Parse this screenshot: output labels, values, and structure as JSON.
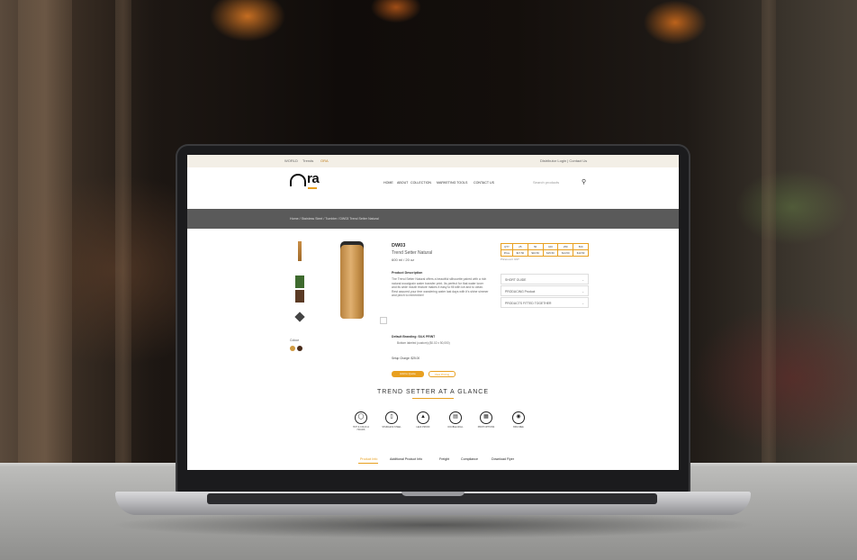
{
  "site": {
    "topbar_left": [
      "WORLD",
      "Trends",
      "ORA"
    ],
    "topbar_right": "Distributor Login | Contact Us",
    "logo_text": "ra",
    "nav": [
      "HOME",
      "ABOUT",
      "COLLECTION",
      "MARKETING TOOLS",
      "CONTACT US"
    ],
    "search_placeholder": "Search products",
    "breadcrumb": "Home / Stainless Steel / Tumbler / DW03 Trend Setter Natural"
  },
  "product": {
    "code": "DW03",
    "name": "Trend Setter Natural",
    "size": "600 ml / 20 oz",
    "desc_heading": "Product Description",
    "description": "The Trend Setter Natural offers a beautiful silhouette paired with a rich natural woodgrain water transfer print. Its perfect for that water lover and its wide mouth feature makes it easy to fill with ice and to clean. Rest assured your free wandering water last days with it's shine simmer and pinch to remember!",
    "branding_heading": "Default Branding: SILK PRINT",
    "branding_item": "Bottom labeled (custom) ($0.02 x 50,000)",
    "setup": "Setup Charge: $25.00",
    "color_label": "Colour",
    "buttons": [
      "Add to Quote",
      "View Pricing"
    ]
  },
  "pricing": {
    "header": [
      "QTY",
      "25",
      "50",
      "100",
      "250",
      "500"
    ],
    "row": [
      "Price",
      "$17.50",
      "$16.50",
      "$15.50",
      "$14.50",
      "$13.50"
    ],
    "note": "Prices excl. GST"
  },
  "accordion": [
    "SHORT GUIDE",
    "PRODUCING Product",
    "PRODUCTS FITTED TOGETHER"
  ],
  "glance_title": "TREND SETTER AT A GLANCE",
  "glance_icons": [
    {
      "icon": "hot-cold-icon",
      "label": "HOT & COLD 12 HOURS"
    },
    {
      "icon": "bottle-icon",
      "label": "STAINLESS STEEL"
    },
    {
      "icon": "drop-icon",
      "label": "LEAK PROOF"
    },
    {
      "icon": "lid-icon",
      "label": "DOUBLE WALL"
    },
    {
      "icon": "print-icon",
      "label": "PRINT OPTIONS"
    },
    {
      "icon": "bpa-icon",
      "label": "BPA FREE"
    }
  ],
  "tabs": [
    "Product Info",
    "Additional Product Info",
    "Freight",
    "Compliance",
    "Download Flyer"
  ],
  "accent": "#e8a020"
}
